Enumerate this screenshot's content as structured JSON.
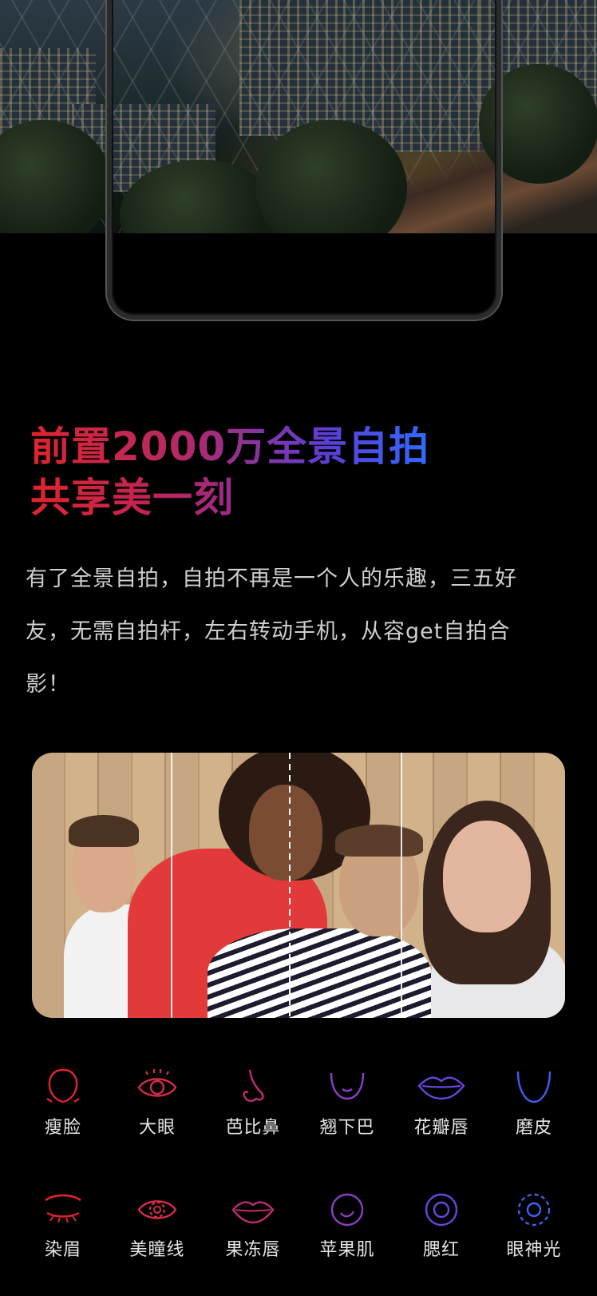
{
  "headline": {
    "line1": "前置2000万全景自拍",
    "line2": "共享美一刻"
  },
  "description": "有了全景自拍，自拍不再是一个人的乐趣，三五好友，无需自拍杆，左右转动手机，从容get自拍合影！",
  "colors": {
    "red": "#e0242c",
    "purple": "#8a3fd6",
    "blue": "#2f6bff"
  },
  "features_row1": [
    {
      "label": "瘦脸",
      "icon": "face-outline-icon"
    },
    {
      "label": "大眼",
      "icon": "eye-icon"
    },
    {
      "label": "芭比鼻",
      "icon": "nose-icon"
    },
    {
      "label": "翘下巴",
      "icon": "chin-icon"
    },
    {
      "label": "花瓣唇",
      "icon": "lips-icon"
    },
    {
      "label": "磨皮",
      "icon": "smooth-skin-icon"
    }
  ],
  "features_row2": [
    {
      "label": "染眉",
      "icon": "eyebrow-icon"
    },
    {
      "label": "美瞳线",
      "icon": "eyeliner-icon"
    },
    {
      "label": "果冻唇",
      "icon": "jelly-lips-icon"
    },
    {
      "label": "苹果肌",
      "icon": "cheek-icon"
    },
    {
      "label": "腮红",
      "icon": "blush-icon"
    },
    {
      "label": "眼神光",
      "icon": "catchlight-icon"
    }
  ]
}
